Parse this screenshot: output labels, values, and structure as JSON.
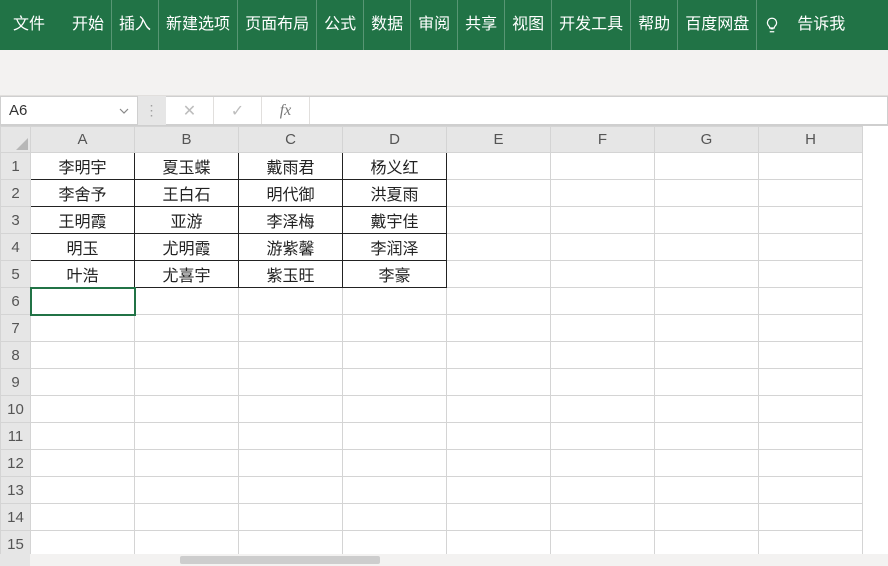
{
  "ribbon": {
    "tabs": [
      "文件",
      "开始",
      "插入",
      "新建选项",
      "页面布局",
      "公式",
      "数据",
      "审阅",
      "共享",
      "视图",
      "开发工具",
      "帮助",
      "百度网盘"
    ],
    "tell_me": "告诉我"
  },
  "namebox": {
    "value": "A6"
  },
  "fx": {
    "cancel": "✕",
    "confirm": "✓",
    "label": "fx",
    "value": ""
  },
  "columns": [
    "A",
    "B",
    "C",
    "D",
    "E",
    "F",
    "G",
    "H"
  ],
  "rows": [
    "1",
    "2",
    "3",
    "4",
    "5",
    "6",
    "7",
    "8",
    "9",
    "10",
    "11",
    "12",
    "13",
    "14",
    "15"
  ],
  "data": {
    "r1": [
      "李明宇",
      "夏玉蝶",
      "戴雨君",
      "杨义红"
    ],
    "r2": [
      "李舍予",
      "王白石",
      "明代御",
      "洪夏雨"
    ],
    "r3": [
      "王明霞",
      "亚游",
      "李泽梅",
      "戴宇佳"
    ],
    "r4": [
      "明玉",
      "尤明霞",
      "游紫馨",
      "李润泽"
    ],
    "r5": [
      "叶浩",
      "尤喜宇",
      "紫玉旺",
      "李豪"
    ]
  },
  "selected_cell": "A6"
}
